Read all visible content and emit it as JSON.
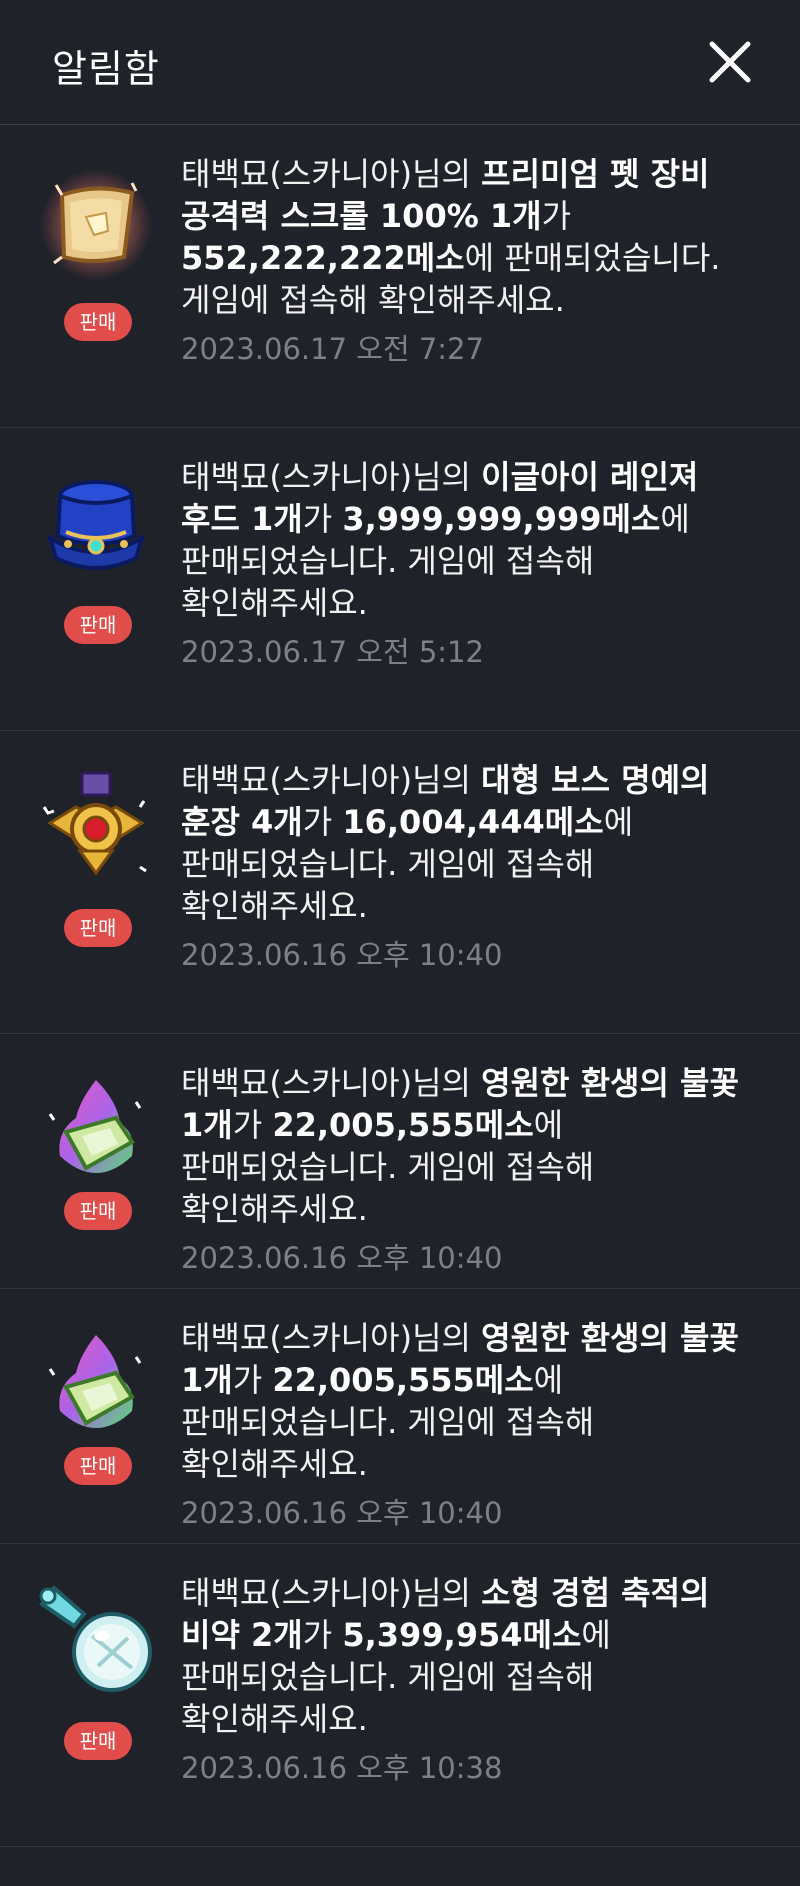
{
  "header": {
    "title": "알림함",
    "close_icon": "close-icon"
  },
  "notifications": [
    {
      "icon": "scroll-icon",
      "badge": "판매",
      "seller": "태백묘(스카니아)",
      "seller_suffix": "님의 ",
      "item_name": "프리미엄 펫 장비 공격력 스크롤 100% 1개",
      "item_suffix": "가 ",
      "price": "552,222,222메소",
      "rest": "에 판매되었습니다. 게임에 접속해 확인해주세요.",
      "time": "2023.06.17 오전 7:27"
    },
    {
      "icon": "hood-icon",
      "badge": "판매",
      "seller": "태백묘(스카니아)",
      "seller_suffix": "님의 ",
      "item_name": "이글아이 레인져 후드 1개",
      "item_suffix": "가 ",
      "price": "3,999,999,999메소",
      "rest": "에 판매되었습니다. 게임에 접속해 확인해주세요.",
      "time": "2023.06.17 오전 5:12"
    },
    {
      "icon": "medal-icon",
      "badge": "판매",
      "seller": "태백묘(스카니아)",
      "seller_suffix": "님의 ",
      "item_name": "대형 보스 명예의 훈장 4개",
      "item_suffix": "가 ",
      "price": "16,004,444메소",
      "rest": "에 판매되었습니다. 게임에 접속해 확인해주세요.",
      "time": "2023.06.16 오후 10:40"
    },
    {
      "icon": "flame-icon",
      "badge": "판매",
      "seller": "태백묘(스카니아)",
      "seller_suffix": "님의 ",
      "item_name": "영원한 환생의 불꽃 1개",
      "item_suffix": "가 ",
      "price": "22,005,555메소",
      "rest": "에 판매되었습니다. 게임에 접속해 확인해주세요.",
      "time": "2023.06.16 오후 10:40"
    },
    {
      "icon": "flame-icon",
      "badge": "판매",
      "seller": "태백묘(스카니아)",
      "seller_suffix": "님의 ",
      "item_name": "영원한 환생의 불꽃 1개",
      "item_suffix": "가 ",
      "price": "22,005,555메소",
      "rest": "에 판매되었습니다. 게임에 접속해 확인해주세요.",
      "time": "2023.06.16 오후 10:40"
    },
    {
      "icon": "potion-icon",
      "badge": "판매",
      "seller": "태백묘(스카니아)",
      "seller_suffix": "님의 ",
      "item_name": "소형 경험 축적의 비약 2개",
      "item_suffix": "가 ",
      "price": "5,399,954메소",
      "rest": "에 판매되었습니다. 게임에 접속해 확인해주세요.",
      "time": "2023.06.16 오후 10:38"
    }
  ]
}
